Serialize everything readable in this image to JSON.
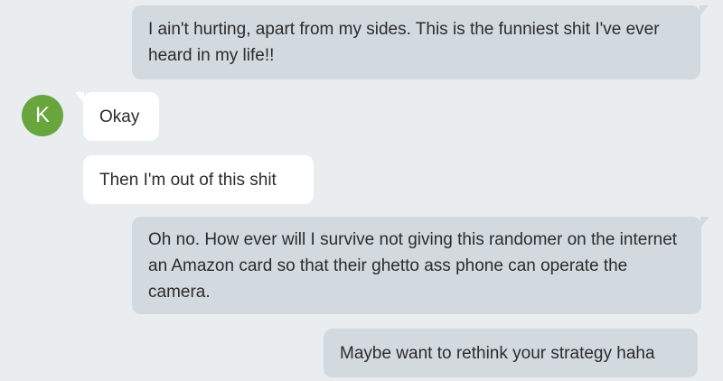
{
  "contact": {
    "avatar_initial": "K",
    "avatar_color": "#68a53d"
  },
  "colors": {
    "background": "#e9edf0",
    "outgoing_bubble": "#d2d9df",
    "incoming_bubble": "#ffffff",
    "text": "#2c2c2c"
  },
  "messages": [
    {
      "direction": "outgoing",
      "text": "I ain't hurting, apart from my sides. This is the funniest shit I've ever heard in my life!!"
    },
    {
      "direction": "incoming",
      "text": "Okay"
    },
    {
      "direction": "incoming",
      "text": "Then I'm out of this shit"
    },
    {
      "direction": "outgoing",
      "text": "Oh no. How ever will I survive not giving this randomer on the internet an Amazon card so that their ghetto ass phone can operate the camera."
    },
    {
      "direction": "outgoing",
      "text": "Maybe want to rethink your strategy haha"
    }
  ]
}
